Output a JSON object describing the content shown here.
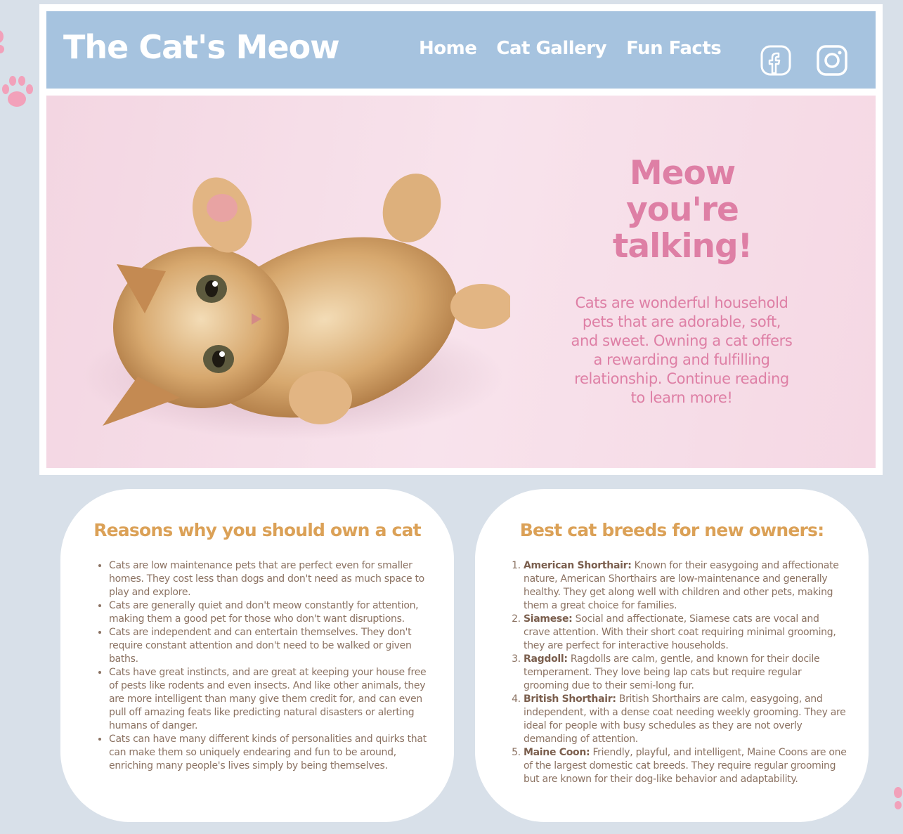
{
  "header": {
    "site_title": "The Cat's Meow",
    "nav": [
      "Home",
      "Cat Gallery",
      "Fun Facts"
    ],
    "social_icons": [
      "facebook-icon",
      "instagram-icon"
    ]
  },
  "hero": {
    "title": "Meow you're talking!",
    "text": "Cats are wonderful household pets that are adorable, soft, and sweet. Owning a cat offers a rewarding and fulfilling relationship. Continue reading to learn more!"
  },
  "reasons": {
    "title": "Reasons why you should own a cat",
    "items": [
      "Cats are low maintenance pets that are perfect even for smaller homes. They cost less than dogs and don't need as much space to play and explore.",
      "Cats are generally quiet and don't meow constantly for attention, making them a good pet for those who don't want disruptions.",
      "Cats are independent and can entertain themselves. They don't require constant attention and don't need to be walked or given baths.",
      "Cats have great instincts, and are great at keeping your house free of pests like rodents and even insects. And like other animals, they are more intelligent than many give them credit for, and can even pull off amazing feats like predicting natural disasters or alerting humans of danger.",
      "Cats can have many different kinds of personalities and quirks that can make them so uniquely endearing and fun to be around, enriching many people's lives simply by being themselves."
    ]
  },
  "breeds": {
    "title": "Best cat breeds for new owners:",
    "items": [
      {
        "name": "American Shorthair:",
        "desc": " Known for their easygoing and affectionate nature, American Shorthairs are low-maintenance and generally healthy. They get along well with children and other pets, making them a great choice for families."
      },
      {
        "name": "Siamese:",
        "desc": " Social and affectionate, Siamese cats are vocal and crave attention. With their short coat requiring minimal grooming, they are perfect for interactive households."
      },
      {
        "name": "Ragdoll:",
        "desc": " Ragdolls are calm, gentle, and known for their docile temperament. They love being lap cats but require regular grooming due to their semi-long fur."
      },
      {
        "name": "British Shorthair:",
        "desc": " British Shorthairs are calm, easygoing, and independent, with a dense coat needing weekly grooming. They are ideal for people with busy schedules as they are not overly demanding of attention."
      },
      {
        "name": "Maine Coon:",
        "desc": " Friendly, playful, and intelligent, Maine Coons are one of the largest domestic cat breeds. They require regular grooming but are known for their dog-like behavior and adaptability."
      }
    ]
  },
  "colors": {
    "background": "#d8e0e9",
    "header": "#a6c3df",
    "hero_pink": "#de7fa5",
    "card_title": "#dba157",
    "body_text": "#8b7262"
  }
}
